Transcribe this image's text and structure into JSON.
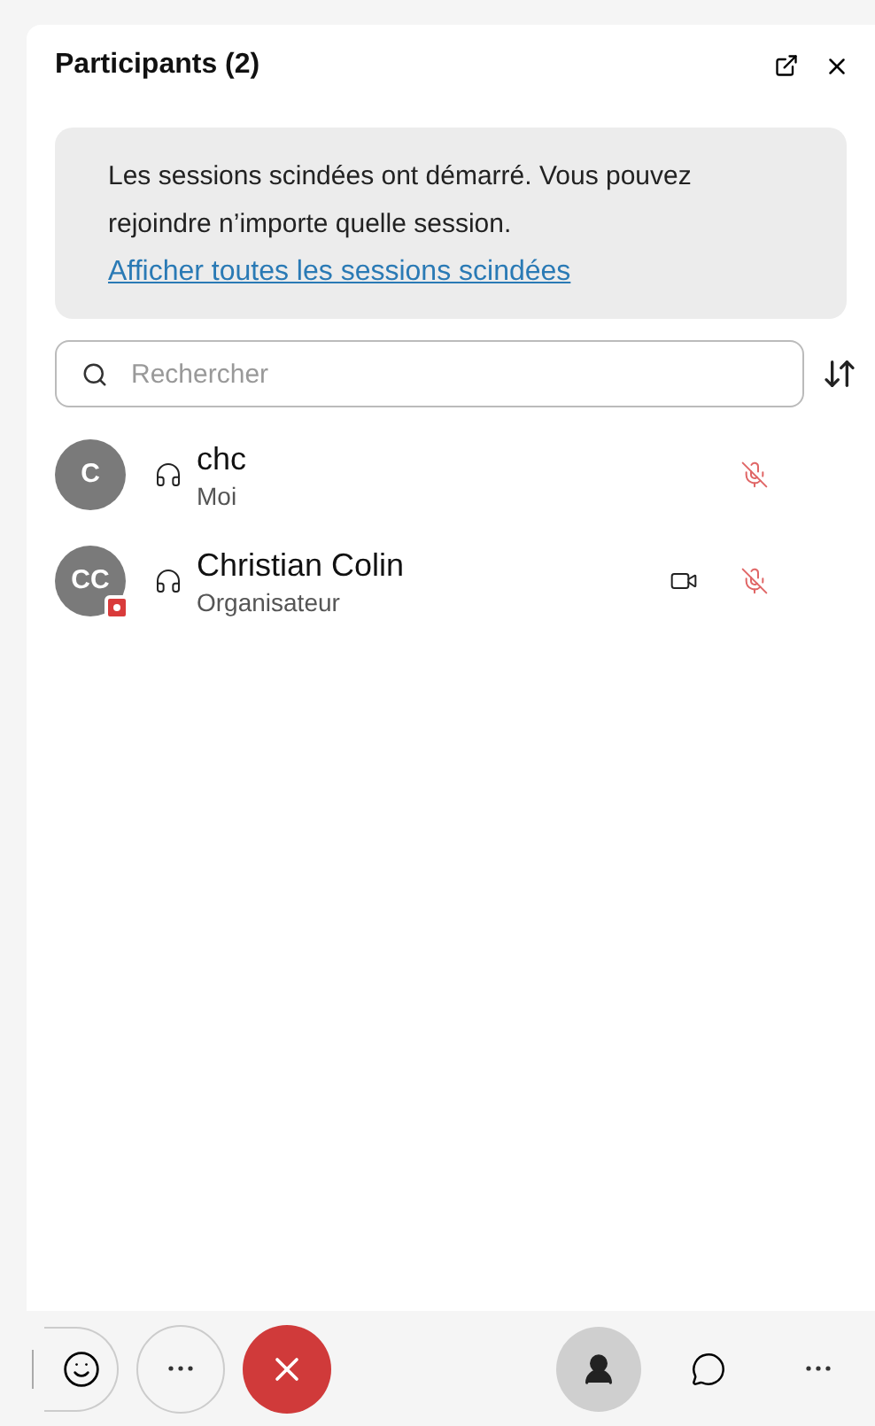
{
  "panel": {
    "title": "Participants (2)"
  },
  "notice": {
    "text": "Les sessions scindées ont démarré. Vous pouvez rejoindre n’importe quelle session.",
    "link": "Afficher toutes les sessions scindées"
  },
  "search": {
    "placeholder": "Rechercher"
  },
  "participants": [
    {
      "initials": "C",
      "name": "chc",
      "role": "Moi",
      "badge": false,
      "video": false,
      "muted": true
    },
    {
      "initials": "CC",
      "name": "Christian Colin",
      "role": "Organisateur",
      "badge": true,
      "video": true,
      "muted": true
    }
  ],
  "toolbar": [
    {
      "kind": "participants",
      "selected": true
    },
    {
      "kind": "chat",
      "selected": false
    },
    {
      "kind": "more",
      "selected": false
    }
  ]
}
